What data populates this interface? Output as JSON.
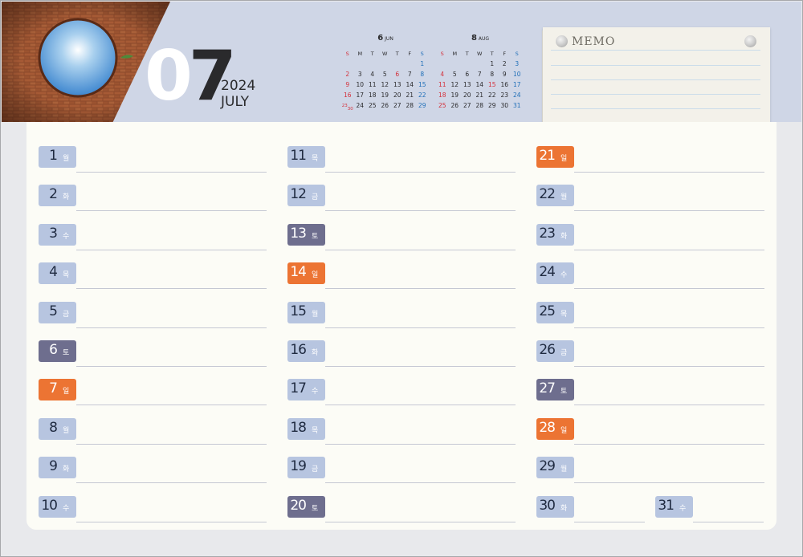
{
  "header": {
    "month_number": "07",
    "year": "2024",
    "month_name": "JULY",
    "colors": {
      "header_bg": "#cfd6e6",
      "weekday": "#b7c5e0",
      "saturday": "#6e6e8e",
      "sunday": "#ec7433"
    }
  },
  "mini_calendars": [
    {
      "month_number": "6",
      "month_label": "JUN",
      "weekday_headers": [
        "S",
        "M",
        "T",
        "W",
        "T",
        "F",
        "S"
      ],
      "cells": [
        "",
        "",
        "",
        "",
        "",
        "",
        "1",
        "2",
        "3",
        "4",
        "5",
        "6",
        "7",
        "8",
        "9",
        "10",
        "11",
        "12",
        "13",
        "14",
        "15",
        "16",
        "17",
        "18",
        "19",
        "20",
        "21",
        "22",
        "23/30",
        "24",
        "25",
        "26",
        "27",
        "28",
        "29"
      ],
      "red_cells": [
        "6"
      ]
    },
    {
      "month_number": "8",
      "month_label": "AUG",
      "weekday_headers": [
        "S",
        "M",
        "T",
        "W",
        "T",
        "F",
        "S"
      ],
      "cells": [
        "",
        "",
        "",
        "",
        "1",
        "2",
        "3",
        "4",
        "5",
        "6",
        "7",
        "8",
        "9",
        "10",
        "11",
        "12",
        "13",
        "14",
        "15",
        "16",
        "17",
        "18",
        "19",
        "20",
        "21",
        "22",
        "23",
        "24",
        "25",
        "26",
        "27",
        "28",
        "29",
        "30",
        "31"
      ],
      "red_cells": [
        "15"
      ]
    }
  ],
  "memo": {
    "title": "MEMO",
    "pin_icon": "pushpin-icon"
  },
  "days": [
    {
      "day": "1",
      "weekday": "월",
      "type": "weekday"
    },
    {
      "day": "2",
      "weekday": "화",
      "type": "weekday"
    },
    {
      "day": "3",
      "weekday": "수",
      "type": "weekday"
    },
    {
      "day": "4",
      "weekday": "목",
      "type": "weekday"
    },
    {
      "day": "5",
      "weekday": "금",
      "type": "weekday"
    },
    {
      "day": "6",
      "weekday": "토",
      "type": "sat"
    },
    {
      "day": "7",
      "weekday": "일",
      "type": "sun"
    },
    {
      "day": "8",
      "weekday": "월",
      "type": "weekday"
    },
    {
      "day": "9",
      "weekday": "화",
      "type": "weekday"
    },
    {
      "day": "10",
      "weekday": "수",
      "type": "weekday"
    },
    {
      "day": "11",
      "weekday": "목",
      "type": "weekday"
    },
    {
      "day": "12",
      "weekday": "금",
      "type": "weekday"
    },
    {
      "day": "13",
      "weekday": "토",
      "type": "sat"
    },
    {
      "day": "14",
      "weekday": "일",
      "type": "sun"
    },
    {
      "day": "15",
      "weekday": "월",
      "type": "weekday"
    },
    {
      "day": "16",
      "weekday": "화",
      "type": "weekday"
    },
    {
      "day": "17",
      "weekday": "수",
      "type": "weekday"
    },
    {
      "day": "18",
      "weekday": "목",
      "type": "weekday"
    },
    {
      "day": "19",
      "weekday": "금",
      "type": "weekday"
    },
    {
      "day": "20",
      "weekday": "토",
      "type": "sat"
    },
    {
      "day": "21",
      "weekday": "일",
      "type": "sun"
    },
    {
      "day": "22",
      "weekday": "월",
      "type": "weekday"
    },
    {
      "day": "23",
      "weekday": "화",
      "type": "weekday"
    },
    {
      "day": "24",
      "weekday": "수",
      "type": "weekday"
    },
    {
      "day": "25",
      "weekday": "목",
      "type": "weekday"
    },
    {
      "day": "26",
      "weekday": "금",
      "type": "weekday"
    },
    {
      "day": "27",
      "weekday": "토",
      "type": "sat"
    },
    {
      "day": "28",
      "weekday": "일",
      "type": "sun"
    },
    {
      "day": "29",
      "weekday": "월",
      "type": "weekday"
    },
    {
      "day": "30",
      "weekday": "화",
      "type": "weekday"
    },
    {
      "day": "31",
      "weekday": "수",
      "type": "weekday"
    }
  ]
}
